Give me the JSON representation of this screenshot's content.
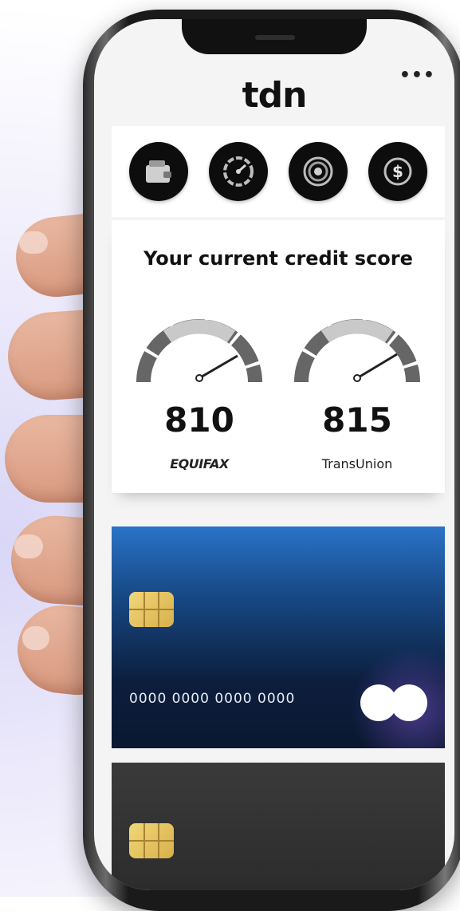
{
  "app": {
    "title": "tdn",
    "more_label": "•••"
  },
  "quick_actions": [
    {
      "icon": "wallet-icon"
    },
    {
      "icon": "speedometer-icon"
    },
    {
      "icon": "target-icon"
    },
    {
      "icon": "dollar-coin-icon"
    }
  ],
  "credit": {
    "title": "Your current credit score",
    "scores": [
      {
        "value": "810",
        "bureau": "EQUIFAX"
      },
      {
        "value": "815",
        "bureau": "TransUnion"
      }
    ]
  },
  "cards": [
    {
      "number": "0000 0000 0000 0000",
      "style": "blue"
    },
    {
      "style": "dark"
    }
  ],
  "colors": {
    "accent": "#184a87",
    "chip": "#e6c25f",
    "dark": "#0d0d0d"
  }
}
